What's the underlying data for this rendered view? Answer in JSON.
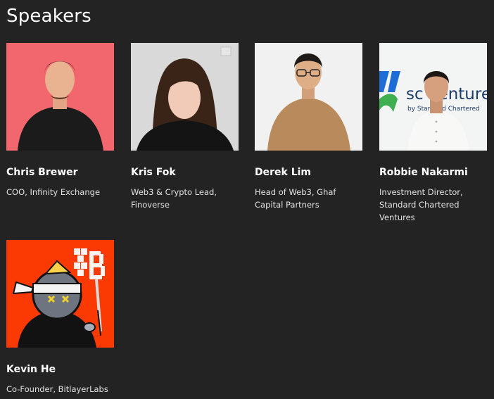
{
  "page": {
    "title": "Speakers"
  },
  "speakers": [
    {
      "name": "Chris Brewer",
      "role": "COO, Infinity Exchange",
      "photo_bg": "#f2666e"
    },
    {
      "name": "Kris Fok",
      "role": "Web3 & Crypto Lead, Finoverse",
      "photo_bg": "#d9d9d9"
    },
    {
      "name": "Derek Lim",
      "role": "Head of Web3, Ghaf Capital Partners",
      "photo_bg": "#f1f1f1"
    },
    {
      "name": "Robbie Nakarmi",
      "role": "Investment Director, Standard Chartered Ventures",
      "photo_bg": "#f3f4f4",
      "backdrop_text": "sc ventures",
      "backdrop_subtext": "by Standard Chartered"
    },
    {
      "name": "Kevin He",
      "role": "Co-Founder, BitlayerLabs",
      "photo_bg": "#fb3a03"
    }
  ],
  "colors": {
    "page_bg": "#232323",
    "text": "#ffffff",
    "subtext": "#e2e2e2"
  }
}
